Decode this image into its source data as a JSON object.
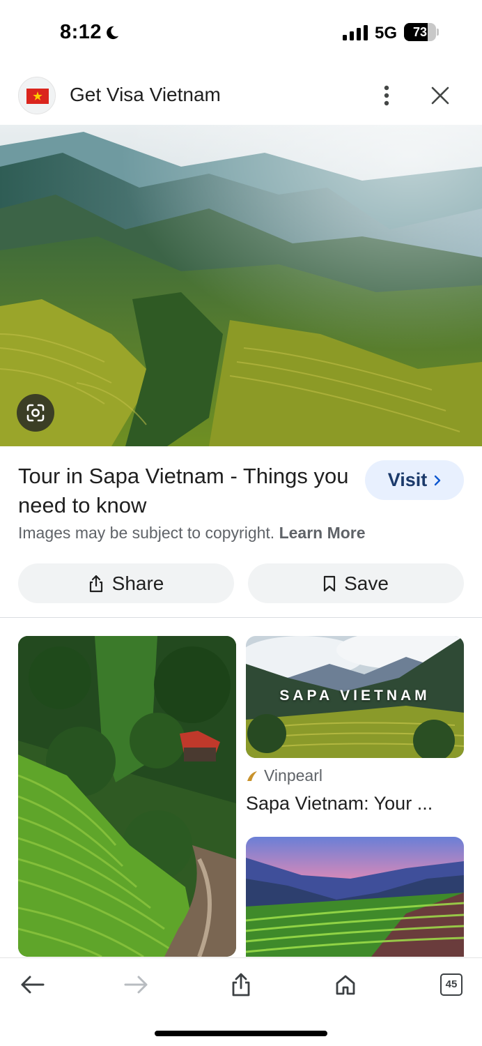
{
  "status_bar": {
    "time": "8:12",
    "network": "5G",
    "battery": "73",
    "battery_level_percent": 73,
    "icons": [
      "moon-icon",
      "signal-icon",
      "battery-icon"
    ]
  },
  "header": {
    "site_name": "Get Visa Vietnam",
    "logo": "vietnam-flag-icon",
    "more_icon": "more-vertical-icon",
    "close_icon": "close-icon"
  },
  "result": {
    "title": "Tour in Sapa Vietnam - Things you need to know",
    "visit_label": "Visit",
    "copyright_text": "Images may be subject to copyright.",
    "learn_more": "Learn More",
    "share_label": "Share",
    "save_label": "Save",
    "lens_icon": "google-lens-icon"
  },
  "related": {
    "card_overlay_text": "SAPA VIETNAM",
    "source_name": "Vinpearl",
    "caption": "Sapa Vietnam: Your ..."
  },
  "toolbar": {
    "tabs_count": "45",
    "icons": [
      "back-arrow-icon",
      "forward-arrow-icon",
      "share-icon",
      "home-icon",
      "tabs-icon"
    ]
  },
  "colors": {
    "visit_bg": "#e8f0fe",
    "chip_bg": "#f1f3f4",
    "secondary_text": "#5f6368",
    "flag_red": "#da251d",
    "flag_star": "#ffcd00"
  }
}
